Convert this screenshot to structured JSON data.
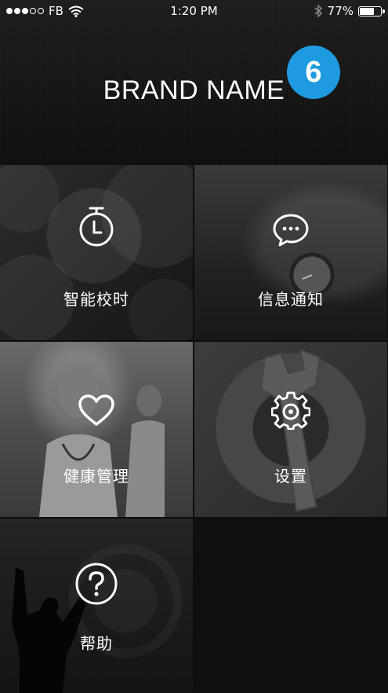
{
  "status_bar": {
    "carrier": "FB",
    "time": "1:20 PM",
    "battery_percent": "77%",
    "battery_level": 0.77,
    "signal_dots_filled": 3,
    "signal_dots_total": 5
  },
  "header": {
    "brand": "BRAND NAME",
    "badge_count": "6",
    "badge_color": "#1e9be0"
  },
  "menu": {
    "items": [
      {
        "label": "智能校时",
        "icon": "stopwatch-icon"
      },
      {
        "label": "信息通知",
        "icon": "chat-bubble-icon"
      },
      {
        "label": "健康管理",
        "icon": "heart-icon"
      },
      {
        "label": "设置",
        "icon": "gear-icon"
      },
      {
        "label": "帮助",
        "icon": "question-icon"
      }
    ]
  }
}
